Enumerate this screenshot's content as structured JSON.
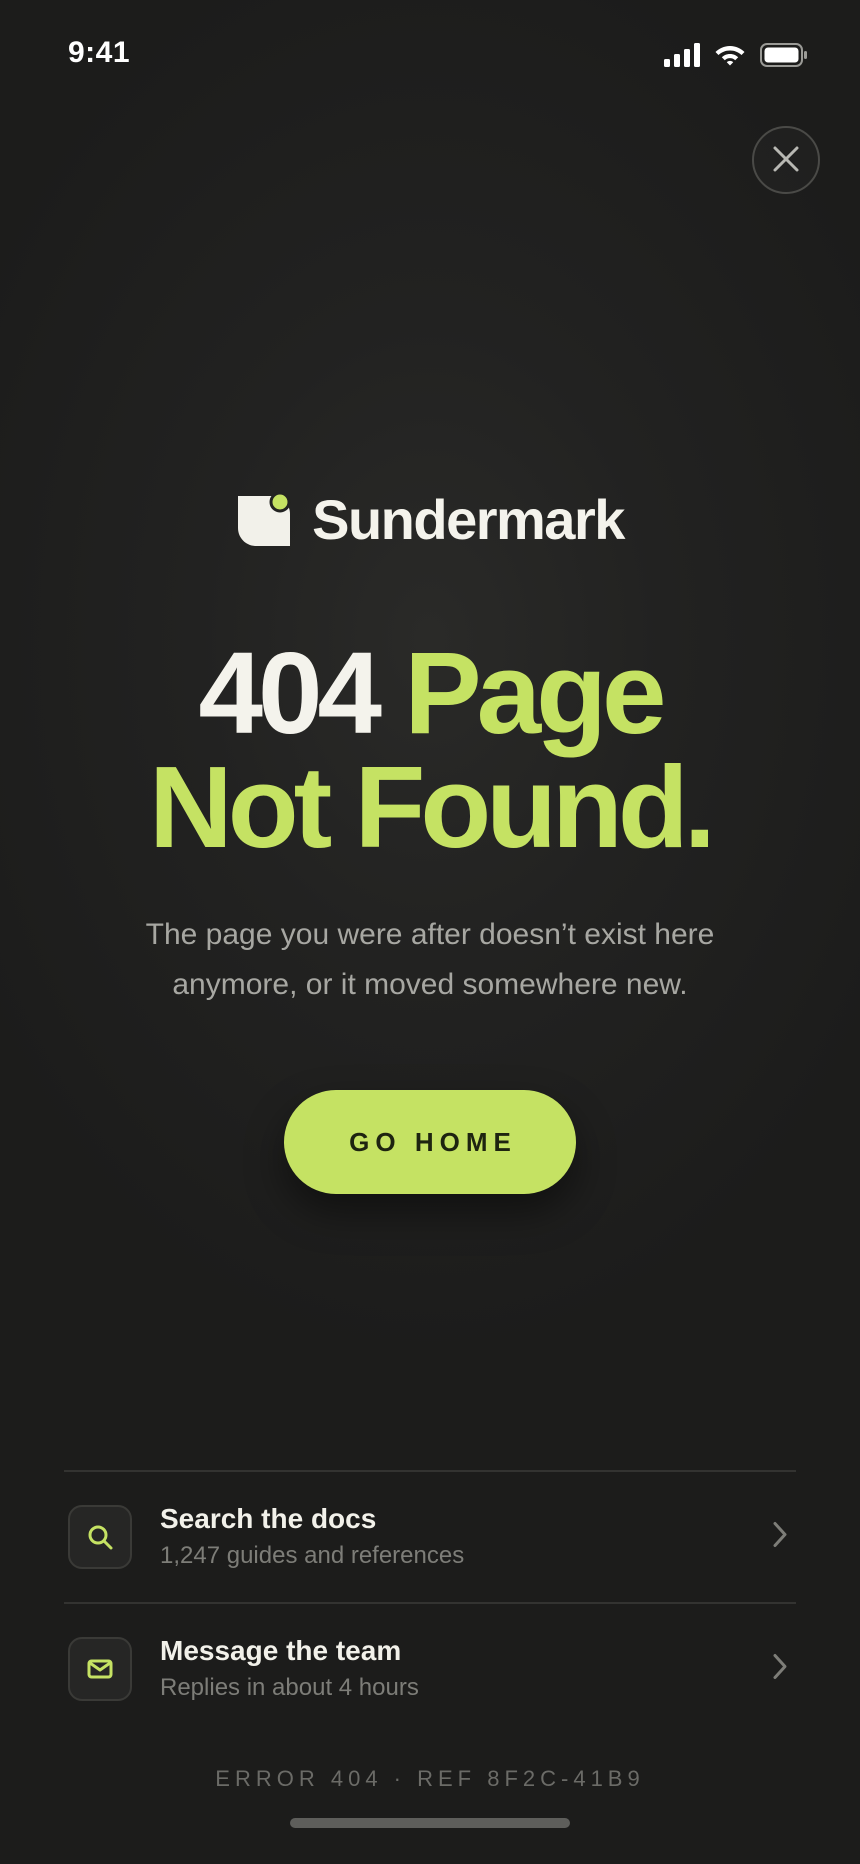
{
  "status_bar": {
    "time": "9:41"
  },
  "brand": {
    "name": "Sundermark",
    "logo_icon": "leaf-logo-icon"
  },
  "headline": {
    "number": "404",
    "line1_accent": "Page",
    "line2": "Not Found."
  },
  "description": "The page you were after doesn’t exist here anymore, or it moved somewhere new.",
  "cta": {
    "label": "GO HOME"
  },
  "help_links": [
    {
      "icon": "search-icon",
      "title": "Search the docs",
      "subtitle": "1,247 guides and references"
    },
    {
      "icon": "mail-icon",
      "title": "Message the team",
      "subtitle": "Replies in about 4 hours"
    }
  ],
  "footer": {
    "error_ref": "ERROR 404 · REF 8F2C-41B9"
  },
  "colors": {
    "background": "#1c1c1b",
    "accent_lime": "#c5e263",
    "text_primary": "#f4f3ec",
    "text_secondary": "#a7a7a2",
    "text_muted": "#7d7d78"
  }
}
